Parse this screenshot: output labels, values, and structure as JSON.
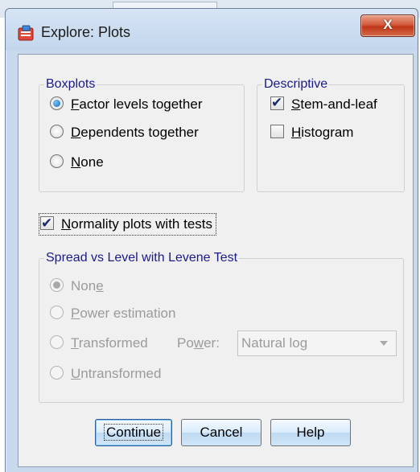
{
  "window": {
    "title": "Explore: Plots",
    "close_label": "X"
  },
  "boxplots": {
    "legend": "Boxplots",
    "options": [
      {
        "pre": "",
        "u": "F",
        "post": "actor levels together",
        "checked": true
      },
      {
        "pre": "",
        "u": "D",
        "post": "ependents together",
        "checked": false
      },
      {
        "pre": "",
        "u": "N",
        "post": "one",
        "checked": false
      }
    ]
  },
  "descriptive": {
    "legend": "Descriptive",
    "options": [
      {
        "pre": "",
        "u": "S",
        "post": "tem-and-leaf",
        "checked": true
      },
      {
        "pre": "",
        "u": "H",
        "post": "istogram",
        "checked": false
      }
    ]
  },
  "normality": {
    "pre": "",
    "u": "N",
    "post": "ormality plots with tests",
    "checked": true
  },
  "spread": {
    "legend": "Spread vs Level with Levene Test",
    "options": [
      {
        "pre": "Non",
        "u": "e",
        "post": "",
        "checked": true
      },
      {
        "pre": "",
        "u": "P",
        "post": "ower estimation",
        "checked": false
      },
      {
        "pre": "",
        "u": "T",
        "post": "ransformed",
        "checked": false
      },
      {
        "pre": "",
        "u": "U",
        "post": "ntransformed",
        "checked": false
      }
    ],
    "power": {
      "pre": "Po",
      "u": "w",
      "post": "er:",
      "value": "Natural log"
    }
  },
  "buttons": {
    "continue": "Continue",
    "cancel": "Cancel",
    "help": "Help"
  },
  "colors": {
    "legend_text": "#1a1a8a",
    "disabled_text": "#9b9b9b",
    "close_button": "#c9452a"
  }
}
